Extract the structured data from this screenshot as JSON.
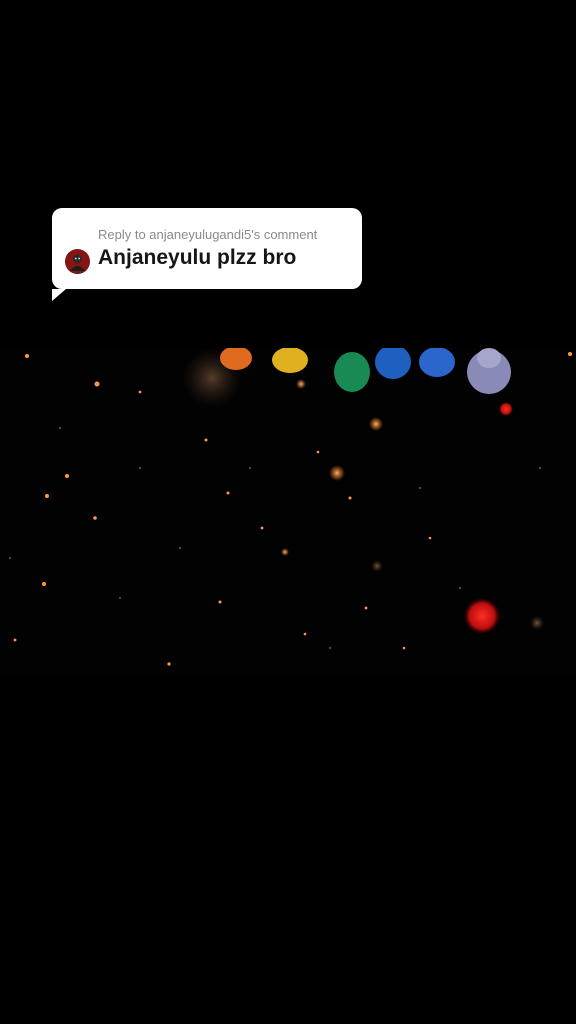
{
  "reply_card": {
    "reply_to": "Reply to anjaneyulugandi5's comment",
    "comment": "Anjaneyulu plzz bro"
  },
  "icons": {
    "avatar": "user-avatar-icon"
  }
}
